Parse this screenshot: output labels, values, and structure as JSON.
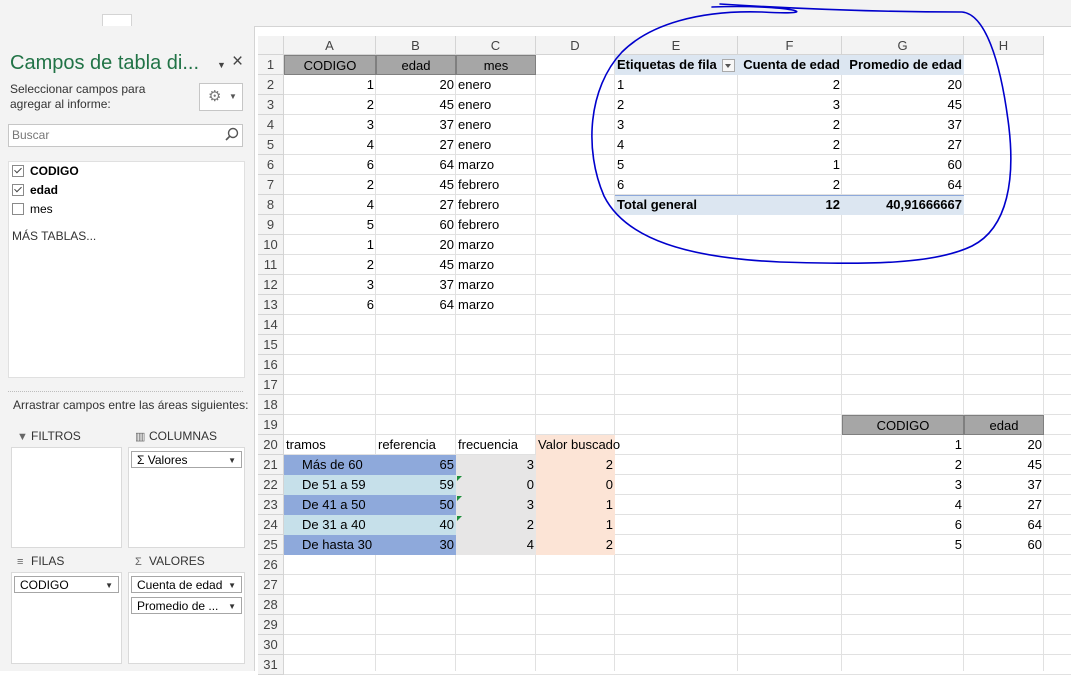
{
  "panel": {
    "title": "Campos de tabla di...",
    "instruction": "Seleccionar campos para agregar al informe:",
    "search_placeholder": "Buscar",
    "fields": [
      {
        "label": "CODIGO",
        "checked": true
      },
      {
        "label": "edad",
        "checked": true
      },
      {
        "label": "mes",
        "checked": false
      }
    ],
    "more_tables": "MÁS TABLAS...",
    "drag_label": "Arrastrar campos entre las áreas siguientes:",
    "areas": {
      "filters": "FILTROS",
      "columns": "COLUMNAS",
      "rows": "FILAS",
      "values": "VALORES"
    },
    "columns_items": [
      "Σ  Valores"
    ],
    "rows_items": [
      "CODIGO"
    ],
    "values_items": [
      "Cuenta de edad",
      "Promedio de ..."
    ]
  },
  "sheet": {
    "columns": [
      "A",
      "B",
      "C",
      "D",
      "E",
      "F",
      "G",
      "H"
    ],
    "row_numbers": [
      "1",
      "2",
      "3",
      "4",
      "5",
      "6",
      "7",
      "8",
      "9",
      "10",
      "11",
      "12",
      "13",
      "14",
      "15",
      "16",
      "17",
      "18",
      "19",
      "20",
      "21",
      "22",
      "23",
      "24",
      "25",
      "26",
      "27",
      "28",
      "29",
      "30",
      "31"
    ],
    "source_table": {
      "headers": [
        "CODIGO",
        "edad",
        "mes"
      ],
      "rows": [
        [
          "1",
          "20",
          "enero"
        ],
        [
          "2",
          "45",
          "enero"
        ],
        [
          "3",
          "37",
          "enero"
        ],
        [
          "4",
          "27",
          "enero"
        ],
        [
          "6",
          "64",
          "marzo"
        ],
        [
          "2",
          "45",
          "febrero"
        ],
        [
          "4",
          "27",
          "febrero"
        ],
        [
          "5",
          "60",
          "febrero"
        ],
        [
          "1",
          "20",
          "marzo"
        ],
        [
          "2",
          "45",
          "marzo"
        ],
        [
          "3",
          "37",
          "marzo"
        ],
        [
          "6",
          "64",
          "marzo"
        ]
      ]
    },
    "pivot": {
      "headers": [
        "Etiquetas de fila",
        "Cuenta de edad",
        "Promedio de edad"
      ],
      "rows": [
        [
          "1",
          "2",
          "20"
        ],
        [
          "2",
          "3",
          "45"
        ],
        [
          "3",
          "2",
          "37"
        ],
        [
          "4",
          "2",
          "27"
        ],
        [
          "5",
          "1",
          "60"
        ],
        [
          "6",
          "2",
          "64"
        ]
      ],
      "total": [
        "Total general",
        "12",
        "40,91666667"
      ]
    },
    "tramos": {
      "headers": [
        "tramos",
        "referencia",
        "frecuencia",
        "Valor buscado"
      ],
      "rows": [
        [
          "Más de 60",
          "65",
          "3",
          "2"
        ],
        [
          "De 51 a 59",
          "59",
          "0",
          "0"
        ],
        [
          "De 41 a 50",
          "50",
          "3",
          "1"
        ],
        [
          "De 31 a 40",
          "40",
          "2",
          "1"
        ],
        [
          "De hasta 30",
          "30",
          "4",
          "2"
        ]
      ]
    },
    "codigo_edad": {
      "headers": [
        "CODIGO",
        "edad"
      ],
      "rows": [
        [
          "1",
          "20"
        ],
        [
          "2",
          "45"
        ],
        [
          "3",
          "37"
        ],
        [
          "4",
          "27"
        ],
        [
          "6",
          "64"
        ],
        [
          "5",
          "60"
        ]
      ]
    }
  },
  "colors": {
    "panel_title": "#217346",
    "pivot_total_fill": "#dce6f1",
    "tramos_dark_blue": "#8ea9db",
    "tramos_light_blue": "#c6e0ea",
    "frecuencia_gray": "#e7e6e6",
    "valor_buscado_peach": "#fce4d6",
    "annotation_ink": "#0000cc"
  }
}
